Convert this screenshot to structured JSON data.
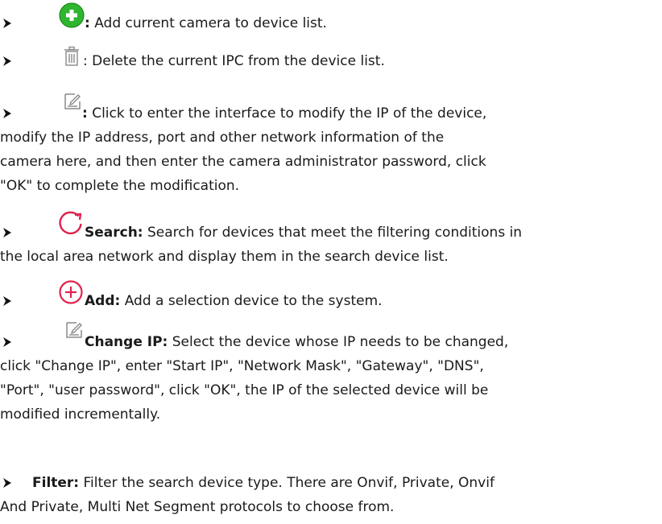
{
  "items": [
    {
      "icon": "add-green-circle-icon",
      "label": ":",
      "text": " Add current camera to device list."
    },
    {
      "icon": "trash-icon",
      "label": "",
      "text": ": Delete the current IPC from the device list."
    },
    {
      "icon": "edit-icon",
      "label": ":",
      "text": " Click to enter the interface to modify the IP of the device,",
      "cont": [
        "modify the IP address, port and other network information of the",
        "camera here, and then enter the camera administrator password, click",
        "\"OK\" to complete the modification."
      ]
    },
    {
      "icon": "refresh-icon",
      "label": "Search:",
      "text": " Search for devices that meet the filtering conditions in",
      "cont": [
        "the local area network and display them in the search device list."
      ]
    },
    {
      "icon": "add-circle-outline-icon",
      "label": "Add:",
      "text": " Add a selection device to the system."
    },
    {
      "icon": "edit-icon",
      "label": "Change IP:",
      "text": " Select the device whose IP needs to be changed,",
      "cont": [
        "click \"Change IP\", enter \"Start IP\", \"Network Mask\", \"Gateway\", \"DNS\",",
        "\"Port\", \"user password\", click \"OK\", the IP of the selected device will be",
        "modified incrementally."
      ]
    },
    {
      "icon": "",
      "label": "Filter:",
      "text": " Filter the search device type. There are Onvif, Private, Onvif",
      "cont": [
        "And Private, Multi Net Segment protocols to choose from."
      ]
    }
  ],
  "colors": {
    "green": "#2fb52f",
    "red": "#e0224d",
    "grey": "#8a8a8a"
  }
}
